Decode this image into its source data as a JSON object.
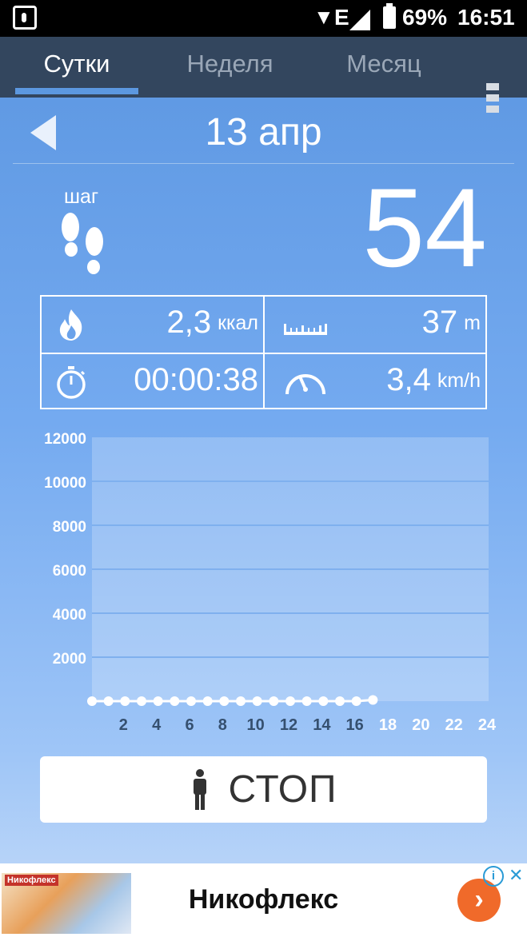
{
  "status_bar": {
    "net": "E",
    "battery": "69%",
    "time": "16:51"
  },
  "tabs": [
    {
      "label": "Сутки",
      "active": true
    },
    {
      "label": "Неделя",
      "active": false
    },
    {
      "label": "Месяц",
      "active": false
    }
  ],
  "date": "13 апр",
  "steps": {
    "label": "шаг",
    "value": "54"
  },
  "stats": {
    "calories": {
      "value": "2,3",
      "unit": "ккал",
      "icon": "flame-icon"
    },
    "distance": {
      "value": "37",
      "unit": "m",
      "icon": "ruler-icon"
    },
    "duration": {
      "value": "00:00:38",
      "unit": "",
      "icon": "stopwatch-icon"
    },
    "speed": {
      "value": "3,4",
      "unit": "km/h",
      "icon": "speedometer-icon"
    }
  },
  "chart_data": {
    "type": "line",
    "y_ticks": [
      "12000",
      "10000",
      "8000",
      "6000",
      "4000",
      "2000"
    ],
    "x_ticks": [
      "2",
      "4",
      "6",
      "8",
      "10",
      "12",
      "14",
      "16",
      "18",
      "20",
      "22",
      "24"
    ],
    "ylim": [
      0,
      12000
    ],
    "xlim": [
      0,
      24
    ],
    "series": [
      {
        "x": [
          0,
          1,
          2,
          3,
          4,
          5,
          6,
          7,
          8,
          9,
          10,
          11,
          12,
          13,
          14,
          15,
          16,
          17
        ],
        "values": [
          0,
          0,
          0,
          0,
          0,
          0,
          0,
          0,
          0,
          0,
          0,
          0,
          0,
          0,
          0,
          0,
          0,
          54
        ]
      }
    ]
  },
  "stop_button": {
    "label": "СТОП"
  },
  "ad": {
    "brand": "Никофлекс",
    "title": "Никофлекс"
  },
  "colors": {
    "tabbar": "#33465e",
    "accent": "#5c98e0",
    "ad_button": "#f06a2a"
  }
}
